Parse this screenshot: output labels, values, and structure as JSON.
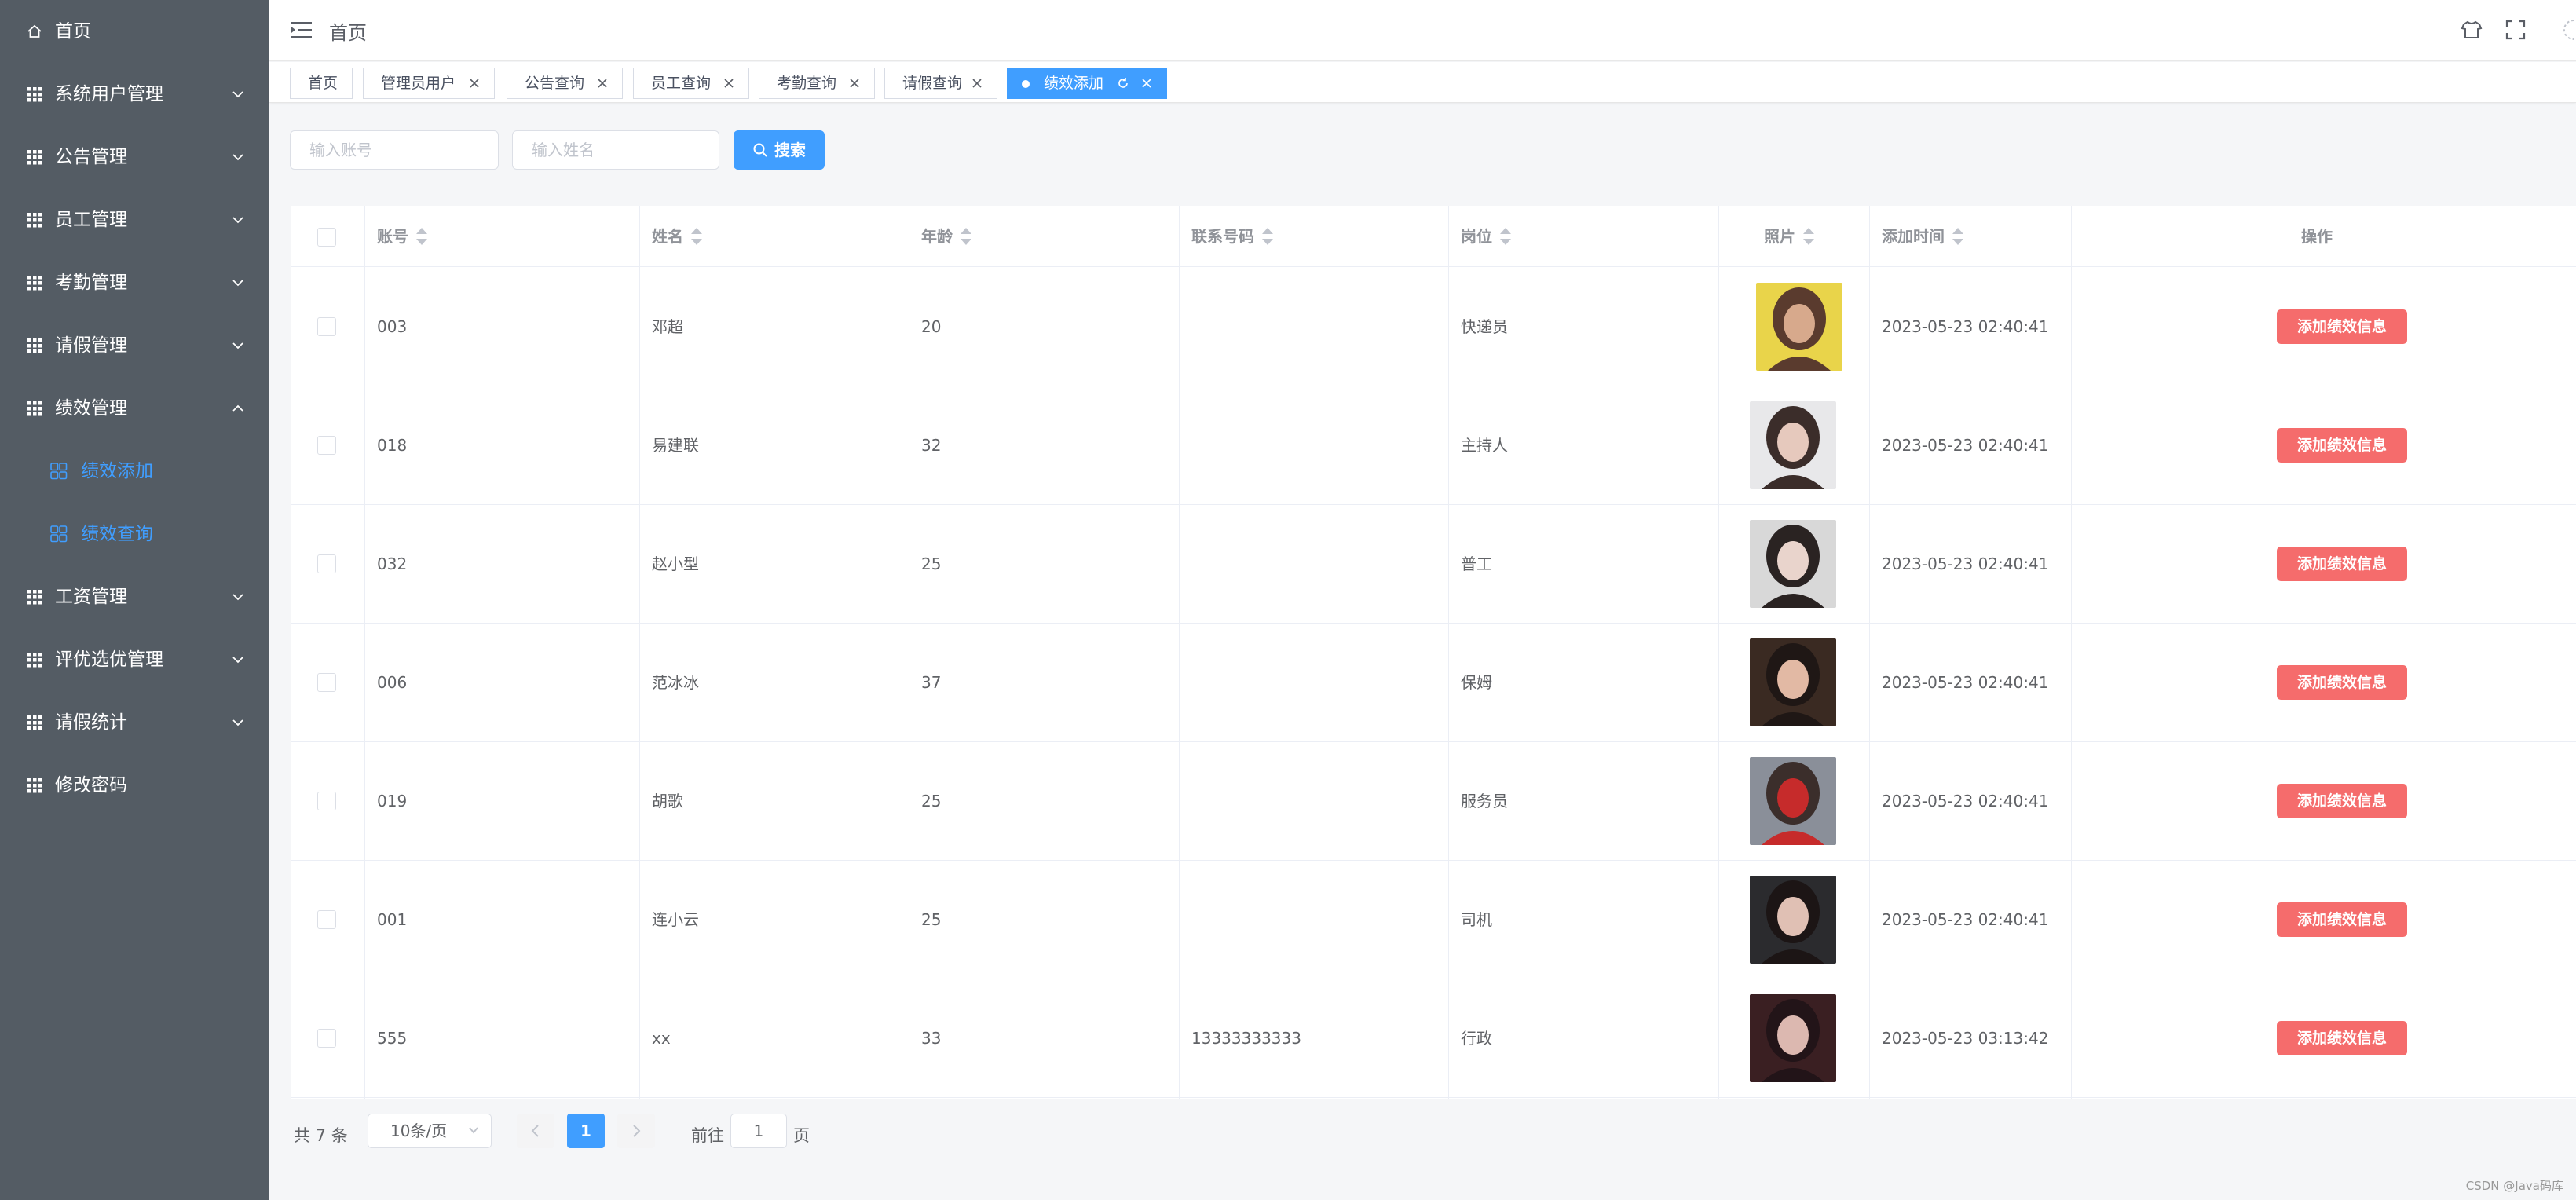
{
  "sidebar": {
    "items": [
      {
        "label": "首页",
        "icon": "home-icon",
        "has_arrow": false
      },
      {
        "label": "系统用户管理",
        "icon": "grid-icon",
        "has_arrow": true,
        "expanded": false
      },
      {
        "label": "公告管理",
        "icon": "grid-icon",
        "has_arrow": true,
        "expanded": false
      },
      {
        "label": "员工管理",
        "icon": "grid-icon",
        "has_arrow": true,
        "expanded": false
      },
      {
        "label": "考勤管理",
        "icon": "grid-icon",
        "has_arrow": true,
        "expanded": false
      },
      {
        "label": "请假管理",
        "icon": "grid-icon",
        "has_arrow": true,
        "expanded": false
      },
      {
        "label": "绩效管理",
        "icon": "grid-icon",
        "has_arrow": true,
        "expanded": true
      },
      {
        "label": "工资管理",
        "icon": "grid-icon",
        "has_arrow": true,
        "expanded": false
      },
      {
        "label": "评优选优管理",
        "icon": "grid-icon",
        "has_arrow": true,
        "expanded": false
      },
      {
        "label": "请假统计",
        "icon": "grid-icon",
        "has_arrow": true,
        "expanded": false
      },
      {
        "label": "修改密码",
        "icon": "grid-icon",
        "has_arrow": false
      }
    ],
    "subitems": [
      {
        "label": "绩效添加",
        "icon": "apps-icon",
        "active": true
      },
      {
        "label": "绩效查询",
        "icon": "apps-icon",
        "active": false
      }
    ],
    "bg_color": "#545c64",
    "active_color": "#409eff"
  },
  "header": {
    "breadcrumb": "首页"
  },
  "tags": [
    {
      "label": "首页",
      "closable": false,
      "active": false
    },
    {
      "label": "管理员用户",
      "closable": true,
      "active": false
    },
    {
      "label": "公告查询",
      "closable": true,
      "active": false
    },
    {
      "label": "员工查询",
      "closable": true,
      "active": false
    },
    {
      "label": "考勤查询",
      "closable": true,
      "active": false
    },
    {
      "label": "请假查询",
      "closable": true,
      "active": false
    },
    {
      "label": "绩效添加",
      "closable": true,
      "active": true
    }
  ],
  "search": {
    "account_placeholder": "输入账号",
    "name_placeholder": "输入姓名",
    "button_label": "搜索"
  },
  "table": {
    "columns": [
      "账号",
      "姓名",
      "年龄",
      "联系号码",
      "岗位",
      "照片",
      "添加时间",
      "操作"
    ],
    "rows": [
      {
        "account": "003",
        "name": "邓超",
        "age": "20",
        "phone": "",
        "post": "快递员",
        "time": "2023-05-23 02:40:41",
        "action": "添加绩效信息"
      },
      {
        "account": "018",
        "name": "易建联",
        "age": "32",
        "phone": "",
        "post": "主持人",
        "time": "2023-05-23 02:40:41",
        "action": "添加绩效信息"
      },
      {
        "account": "032",
        "name": "赵小型",
        "age": "25",
        "phone": "",
        "post": "普工",
        "time": "2023-05-23 02:40:41",
        "action": "添加绩效信息"
      },
      {
        "account": "006",
        "name": "范冰冰",
        "age": "37",
        "phone": "",
        "post": "保姆",
        "time": "2023-05-23 02:40:41",
        "action": "添加绩效信息"
      },
      {
        "account": "019",
        "name": "胡歌",
        "age": "25",
        "phone": "",
        "post": "服务员",
        "time": "2023-05-23 02:40:41",
        "action": "添加绩效信息"
      },
      {
        "account": "001",
        "name": "连小云",
        "age": "25",
        "phone": "",
        "post": "司机",
        "time": "2023-05-23 02:40:41",
        "action": "添加绩效信息"
      },
      {
        "account": "555",
        "name": "xx",
        "age": "33",
        "phone": "13333333333",
        "post": "行政",
        "time": "2023-05-23 03:13:42",
        "action": "添加绩效信息"
      }
    ],
    "action_color": "#f56c6c"
  },
  "pagination": {
    "total_text": "共 7 条",
    "page_size": "10条/页",
    "current_page": "1",
    "goto_label": "前往",
    "goto_value": "1",
    "page_label": "页"
  },
  "watermark": "CSDN @Java码库"
}
